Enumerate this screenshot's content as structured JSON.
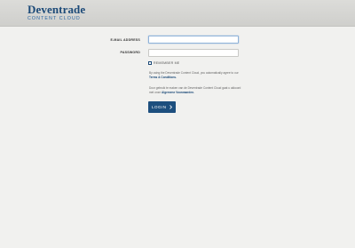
{
  "header": {
    "brand": "Deventrade",
    "subtitle": "CONTENT CLOUD"
  },
  "form": {
    "email_label": "E-MAIL ADDRESS",
    "email_value": "",
    "password_label": "PASSWORD",
    "password_value": "",
    "remember_label": "REMEMBER ME",
    "remember_checked": false,
    "terms_text": "By using the Deventrade Content Cloud, you automatically agree to our",
    "terms_link": "Terms & Conditions.",
    "dutch_text": "Door gebruik te maken van de Deventrade Content Cloud gaat u akkoord met onze",
    "dutch_link": "Algemene Voorwaarden.",
    "login_label": "LOGIN",
    "login_icon": "chevron-right-icon"
  },
  "colors": {
    "brand": "#1c4a78",
    "login_button": "#1d4f7e",
    "background": "#f1f1ef",
    "header": "#d6d6d3"
  }
}
